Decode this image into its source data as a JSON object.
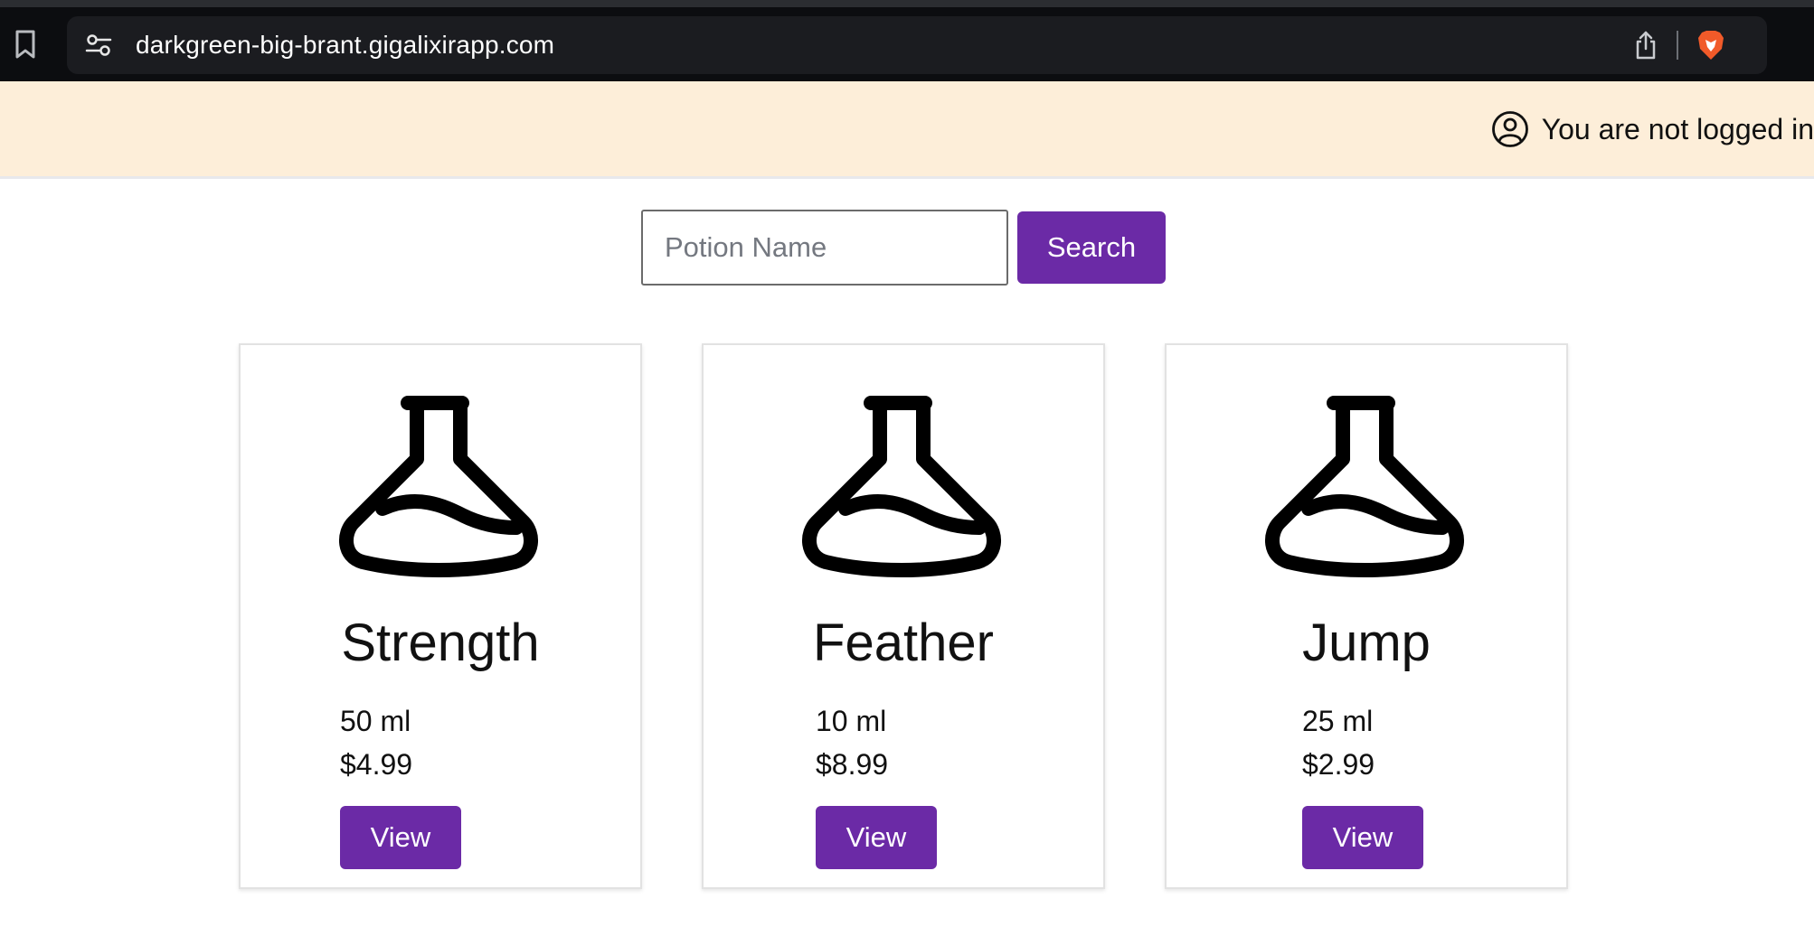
{
  "browser": {
    "url": "darkgreen-big-brant.gigalixirapp.com",
    "icons": {
      "bookmark": "bookmark-icon",
      "site_settings": "sliders-icon",
      "share": "share-icon",
      "brave": "brave-lion-icon"
    }
  },
  "banner": {
    "login_status": "You are not logged in",
    "icon": "user-circle-icon",
    "background": "#fdeed9"
  },
  "search": {
    "placeholder": "Potion Name",
    "value": "",
    "button_label": "Search"
  },
  "theme": {
    "accent": "#6b2aa6"
  },
  "potions": [
    {
      "name": "Strength",
      "volume": "50 ml",
      "price": "$4.99",
      "button_label": "View",
      "icon": "flask-icon"
    },
    {
      "name": "Feather",
      "volume": "10 ml",
      "price": "$8.99",
      "button_label": "View",
      "icon": "flask-icon"
    },
    {
      "name": "Jump",
      "volume": "25 ml",
      "price": "$2.99",
      "button_label": "View",
      "icon": "flask-icon"
    }
  ]
}
